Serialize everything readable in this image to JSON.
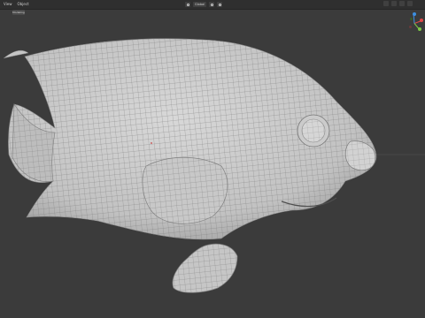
{
  "app": {
    "menu": [
      "View",
      "Object"
    ],
    "workspace_tab": "Modeling",
    "view_mode": "Global"
  },
  "scene": {
    "object": "fish mesh",
    "shading": "solid-gray wireframe"
  },
  "colors": {
    "background": "#3b3b3b",
    "mesh_fill": "#cfcfcf",
    "mesh_wire": "#6f6f6f",
    "gizmo_x": "#e04848",
    "gizmo_y": "#7cc844",
    "gizmo_z": "#3d8fe0"
  }
}
